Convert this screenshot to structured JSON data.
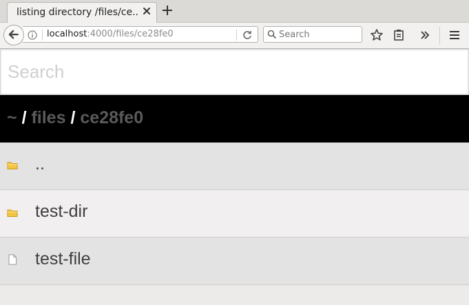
{
  "browser": {
    "tab": {
      "title": "listing directory /files/ce..."
    },
    "url": {
      "host": "localhost",
      "rest": ":4000/files/ce28fe0"
    },
    "search": {
      "placeholder": "Search"
    }
  },
  "page": {
    "search_placeholder": "Search",
    "breadcrumb": {
      "home": "~",
      "separator": "/",
      "segments": [
        "files",
        "ce28fe0"
      ]
    },
    "listing": [
      {
        "name": "..",
        "type": "folder"
      },
      {
        "name": "test-dir",
        "type": "folder"
      },
      {
        "name": "test-file",
        "type": "file"
      }
    ]
  },
  "colors": {
    "breadcrumb_bg": "#000000",
    "breadcrumb_link": "#5a5a5a",
    "row_odd": "#e3e3e3",
    "row_even": "#f1eff0",
    "folder_icon": "#f4c542"
  }
}
